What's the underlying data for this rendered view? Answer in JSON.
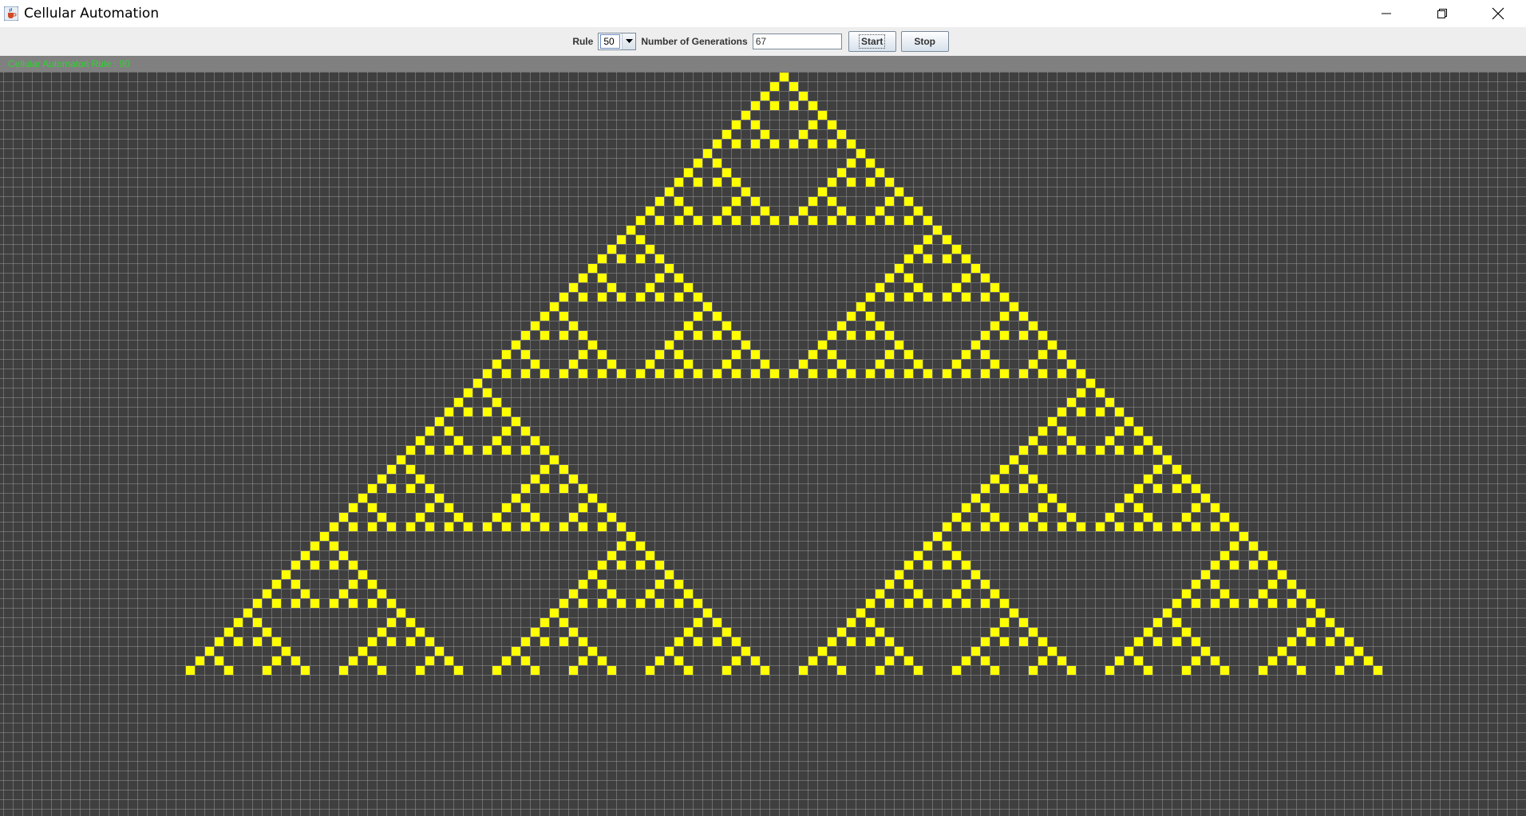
{
  "window": {
    "title": "Cellular Automation",
    "app_icon": "java-cup-icon",
    "controls": [
      "minimize-icon",
      "restore-icon",
      "close-icon"
    ]
  },
  "toolbar": {
    "rule_label": "Rule",
    "rule_value": "50",
    "generations_label": "Number of Generations",
    "generations_value": "67",
    "start_label": "Start",
    "stop_label": "Stop"
  },
  "canvas": {
    "caption": "Cellular Automaton Rule : 90",
    "rule_number": 90,
    "generations_shown": 63,
    "colors": {
      "background": "#3f3f3f",
      "grid_line": "#9a9a9a",
      "alive_cell": "#ffff00",
      "caption": "#2bd62b",
      "status_strip": "#808080"
    }
  }
}
